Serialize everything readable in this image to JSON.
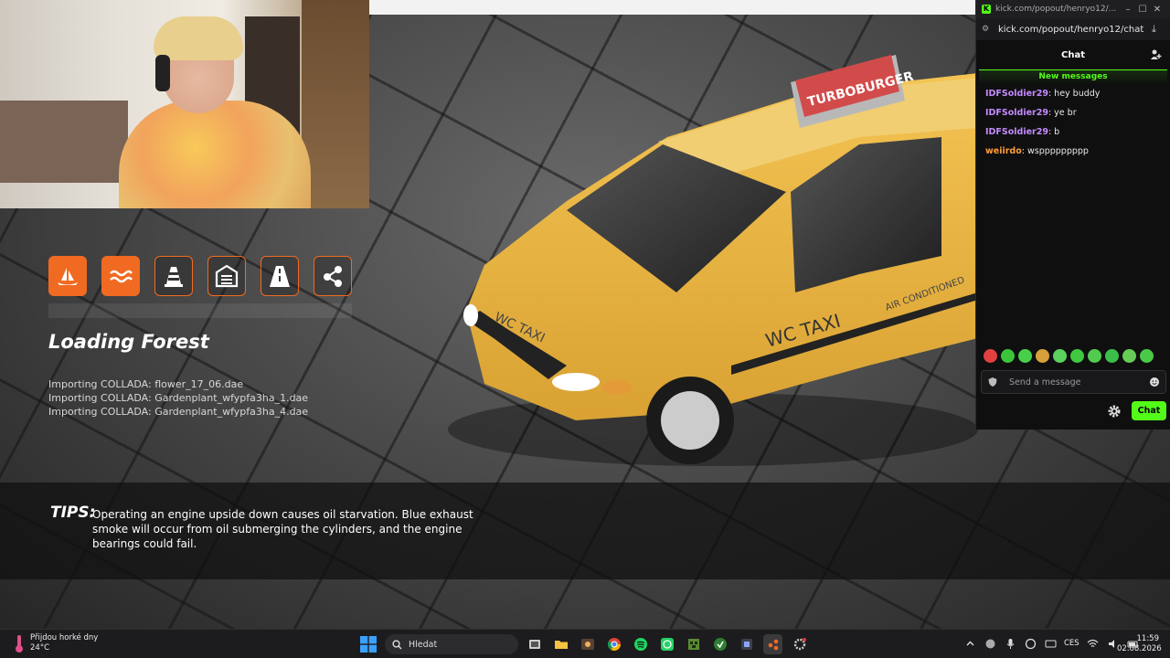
{
  "chat": {
    "window_title": "kick.com/popout/henryo12/...",
    "url": "kick.com/popout/henryo12/chat",
    "header_title": "Chat",
    "new_messages_label": "New messages",
    "messages": [
      {
        "user": "IDFSoldier29",
        "text": ": hey buddy",
        "color": "#c58bff"
      },
      {
        "user": "IDFSoldier29",
        "text": ": ye br",
        "color": "#c58bff"
      },
      {
        "user": "IDFSoldier29",
        "text": ": b",
        "color": "#c58bff"
      },
      {
        "user": "weiirdo",
        "text": ": wsppppppppp",
        "color": "#ff9d3b"
      }
    ],
    "input_placeholder": "Send a message",
    "send_label": "Chat",
    "accent": "#53fc18"
  },
  "game": {
    "mode_icons": [
      "boat-icon",
      "water-icon",
      "traffic-cone-icon",
      "garage-icon",
      "road-icon",
      "network-icon"
    ],
    "loading_title": "Loading Forest",
    "imports": [
      "Importing COLLADA: flower_17_06.dae",
      "Importing COLLADA: Gardenplant_wfypfa3ha_1.dae",
      "Importing COLLADA: Gardenplant_wfypfa3ha_4.dae"
    ],
    "tips_label": "TIPS:",
    "tips_text": "Operating an engine upside down causes oil starvation. Blue exhaust smoke will occur from oil submerging the cylinders, and the engine bearings could fail.",
    "taxi_sign": "TURBOBURGER",
    "taxi_logo": "WC TAXI",
    "taxi_side_text": "AIR CONDITIONED",
    "accent": "#f06a22"
  },
  "taskbar": {
    "weather_title": "Přijdou horké dny",
    "weather_temp": "24°C",
    "search_label": "Hledat",
    "language": "CES",
    "time": "11:59",
    "date": "02.08.2026"
  }
}
